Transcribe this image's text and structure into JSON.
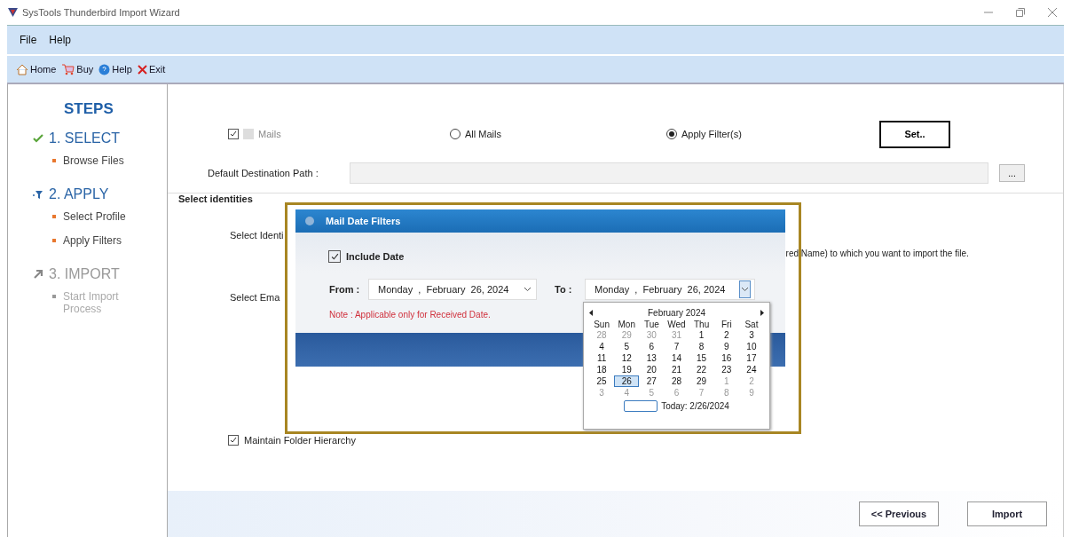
{
  "window": {
    "title": "SysTools Thunderbird Import Wizard"
  },
  "menu": [
    "File",
    "Help"
  ],
  "toolbar": [
    {
      "kind": "home",
      "label": "Home"
    },
    {
      "kind": "buy",
      "label": "Buy"
    },
    {
      "kind": "help",
      "label": "Help"
    },
    {
      "kind": "exit",
      "label": "Exit"
    }
  ],
  "sidebar": {
    "title": "STEPS",
    "steps": [
      {
        "kind": "done",
        "label": "1. SELECT",
        "items": [
          "Browse Files"
        ]
      },
      {
        "kind": "active",
        "label": "2. APPLY",
        "items": [
          "Select Profile",
          "Apply Filters"
        ]
      },
      {
        "kind": "pending",
        "label": "3. IMPORT",
        "items": [
          "Start Import Process"
        ]
      }
    ]
  },
  "options": {
    "mails": {
      "label": "Mails",
      "checked": true
    },
    "radios": [
      {
        "label": "All Mails",
        "selected": false
      },
      {
        "label": "Apply Filter(s)",
        "selected": true
      }
    ],
    "set_button": "Set.."
  },
  "destination": {
    "label": "Default Destination Path :",
    "browse_button": "..."
  },
  "identities": {
    "heading": "Select identities",
    "rows": [
      {
        "label": "Select Identi",
        "description": "red Name) to  which  you want to import the file."
      },
      {
        "label": "Select Ema",
        "description": ""
      }
    ]
  },
  "maintain_hierarchy": {
    "label": "Maintain Folder Hierarchy",
    "checked": true
  },
  "buttons": {
    "previous": "<< Previous",
    "import": "Import"
  },
  "dialog": {
    "title": "Mail Date Filters",
    "include_date": {
      "label": "Include Date",
      "checked": true
    },
    "from": {
      "label": "From :",
      "value": "Monday  ,  February  26, 2024"
    },
    "to": {
      "label": "To :",
      "value": "Monday  ,  February  26, 2024"
    },
    "note": "Note : Applicable only for Received Date.",
    "calendar": {
      "month": "February 2024",
      "weekdays": [
        "Sun",
        "Mon",
        "Tue",
        "Wed",
        "Thu",
        "Fri",
        "Sat"
      ],
      "days": [
        {
          "label": "28",
          "other_month": true,
          "selected": false
        },
        {
          "label": "29",
          "other_month": true,
          "selected": false
        },
        {
          "label": "30",
          "other_month": true,
          "selected": false
        },
        {
          "label": "31",
          "other_month": true,
          "selected": false
        },
        {
          "label": "1",
          "other_month": false,
          "selected": false
        },
        {
          "label": "2",
          "other_month": false,
          "selected": false
        },
        {
          "label": "3",
          "other_month": false,
          "selected": false
        },
        {
          "label": "4",
          "other_month": false,
          "selected": false
        },
        {
          "label": "5",
          "other_month": false,
          "selected": false
        },
        {
          "label": "6",
          "other_month": false,
          "selected": false
        },
        {
          "label": "7",
          "other_month": false,
          "selected": false
        },
        {
          "label": "8",
          "other_month": false,
          "selected": false
        },
        {
          "label": "9",
          "other_month": false,
          "selected": false
        },
        {
          "label": "10",
          "other_month": false,
          "selected": false
        },
        {
          "label": "11",
          "other_month": false,
          "selected": false
        },
        {
          "label": "12",
          "other_month": false,
          "selected": false
        },
        {
          "label": "13",
          "other_month": false,
          "selected": false
        },
        {
          "label": "14",
          "other_month": false,
          "selected": false
        },
        {
          "label": "15",
          "other_month": false,
          "selected": false
        },
        {
          "label": "16",
          "other_month": false,
          "selected": false
        },
        {
          "label": "17",
          "other_month": false,
          "selected": false
        },
        {
          "label": "18",
          "other_month": false,
          "selected": false
        },
        {
          "label": "19",
          "other_month": false,
          "selected": false
        },
        {
          "label": "20",
          "other_month": false,
          "selected": false
        },
        {
          "label": "21",
          "other_month": false,
          "selected": false
        },
        {
          "label": "22",
          "other_month": false,
          "selected": false
        },
        {
          "label": "23",
          "other_month": false,
          "selected": false
        },
        {
          "label": "24",
          "other_month": false,
          "selected": false
        },
        {
          "label": "25",
          "other_month": false,
          "selected": false
        },
        {
          "label": "26",
          "other_month": false,
          "selected": true
        },
        {
          "label": "27",
          "other_month": false,
          "selected": false
        },
        {
          "label": "28",
          "other_month": false,
          "selected": false
        },
        {
          "label": "29",
          "other_month": false,
          "selected": false
        },
        {
          "label": "1",
          "other_month": true,
          "selected": false
        },
        {
          "label": "2",
          "other_month": true,
          "selected": false
        },
        {
          "label": "3",
          "other_month": true,
          "selected": false
        },
        {
          "label": "4",
          "other_month": true,
          "selected": false
        },
        {
          "label": "5",
          "other_month": true,
          "selected": false
        },
        {
          "label": "6",
          "other_month": true,
          "selected": false
        },
        {
          "label": "7",
          "other_month": true,
          "selected": false
        },
        {
          "label": "8",
          "other_month": true,
          "selected": false
        },
        {
          "label": "9",
          "other_month": true,
          "selected": false
        }
      ],
      "today": "Today: 2/26/2024"
    }
  }
}
